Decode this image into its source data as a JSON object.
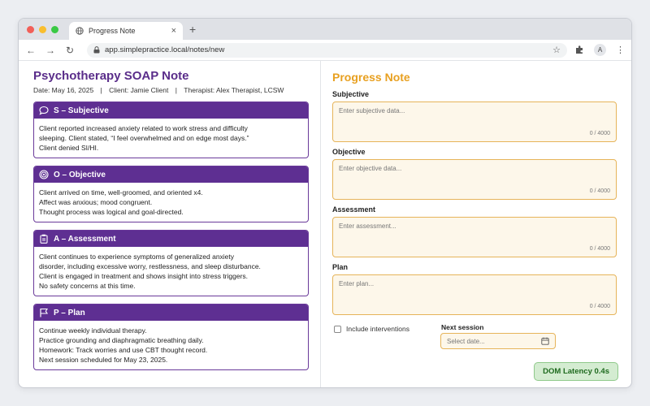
{
  "browser": {
    "tab_title": "Progress Note",
    "url": "app.simplepractice.local/notes/new",
    "avatar_letter": "A"
  },
  "soap": {
    "title": "Psychotherapy SOAP Note",
    "date": "Date: May 16, 2025",
    "client": "Client: Jamie Client",
    "therapist": "Therapist: Alex Therapist, LCSW",
    "sections": [
      {
        "heading": "S – Subjective",
        "icon": "chat-bubble-icon",
        "lines": [
          "Client reported increased anxiety related to work stress and difficulty",
          "sleeping. Client stated, “I feel overwhelmed and on edge most days.”",
          "Client denied SI/HI."
        ]
      },
      {
        "heading": "O – Objective",
        "icon": "target-icon",
        "lines": [
          "Client arrived on time, well-groomed, and oriented x4.",
          "Affect was anxious; mood congruent.",
          "Thought process was logical and goal-directed."
        ]
      },
      {
        "heading": "A – Assessment",
        "icon": "clipboard-icon",
        "lines": [
          "Client continues to experience symptoms of generalized anxiety",
          "disorder, including excessive worry, restlessness, and sleep disturbance.",
          "Client is engaged in treatment and shows insight into stress triggers.",
          "No safety concerns at this time."
        ]
      },
      {
        "heading": "P – Plan",
        "icon": "flag-icon",
        "lines": [
          "Continue weekly individual therapy.",
          "Practice grounding and diaphragmatic breathing daily.",
          "Homework: Track worries and use CBT thought record.",
          "Next session scheduled for May 23, 2025."
        ]
      }
    ]
  },
  "form": {
    "title": "Progress Note",
    "fields": [
      {
        "label": "Subjective",
        "placeholder": "Enter subjective data...",
        "count": "0 / 4000"
      },
      {
        "label": "Objective",
        "placeholder": "Enter objective data...",
        "count": "0 / 4000"
      },
      {
        "label": "Assessment",
        "placeholder": "Enter assessment...",
        "count": "0 / 4000"
      },
      {
        "label": "Plan",
        "placeholder": "Enter plan...",
        "count": "0 / 4000"
      }
    ],
    "include_interventions": "Include interventions",
    "next_session_label": "Next session",
    "next_session_placeholder": "Select date..."
  },
  "latency_badge": "DOM Latency 0.4s",
  "colors": {
    "primary_purple": "#5e2f92",
    "accent_orange": "#e8a020",
    "field_bg": "#fdf7ea",
    "latency_green": "#d4ecd1"
  }
}
